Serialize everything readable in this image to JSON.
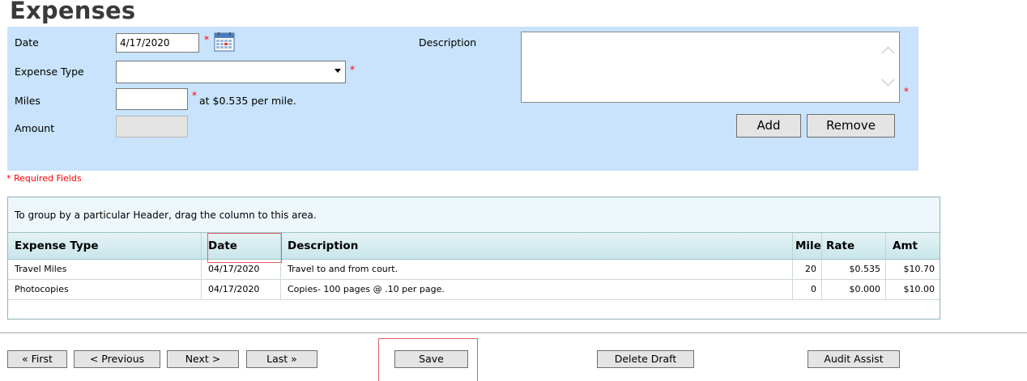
{
  "page_title": "Expenses",
  "form": {
    "date_label": "Date",
    "date_value": "4/17/2020",
    "expense_type_label": "Expense Type",
    "expense_type_value": "",
    "miles_label": "Miles",
    "miles_value": "",
    "miles_rate_text": "at $0.535 per mile.",
    "amount_label": "Amount",
    "description_label": "Description",
    "description_value": "",
    "required_marker": "*",
    "add_label": "Add",
    "remove_label": "Remove"
  },
  "required_note": "* Required Fields",
  "grid": {
    "group_hint": "To group by a particular Header, drag the column to this area.",
    "columns": [
      "Expense Type",
      "Date",
      "Description",
      "Mile",
      "Rate",
      "Amt"
    ],
    "rows": [
      {
        "expense_type": "Travel Miles",
        "date": "04/17/2020",
        "description": "Travel to and from court.",
        "miles": "20",
        "rate": "$0.535",
        "amt": "$10.70"
      },
      {
        "expense_type": "Photocopies",
        "date": "04/17/2020",
        "description": "Copies- 100 pages @ .10 per page.",
        "miles": "0",
        "rate": "$0.000",
        "amt": "$10.00"
      }
    ]
  },
  "nav": {
    "first": "« First",
    "previous": "< Previous",
    "next": "Next >",
    "last": "Last »",
    "save": "Save",
    "delete_draft": "Delete Draft",
    "audit_assist": "Audit Assist"
  },
  "icons": {
    "calendar": "calendar-icon",
    "dropdown": "chevron-down-icon"
  },
  "colors": {
    "panel_bg": "#c8e3fb",
    "required_red": "#ff0000",
    "highlight_box": "#e06060"
  }
}
